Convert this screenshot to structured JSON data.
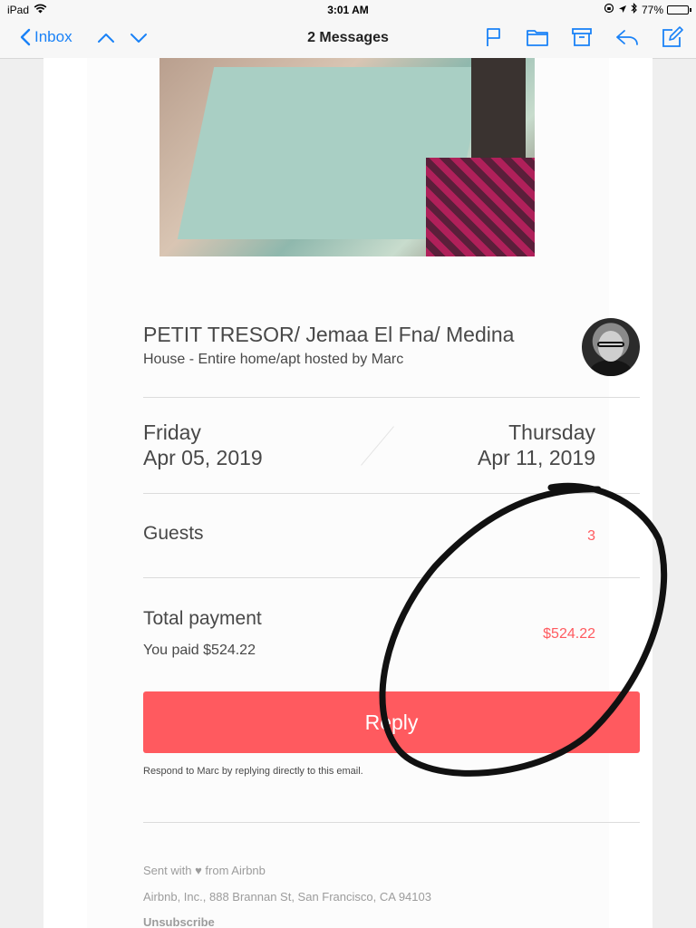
{
  "status_bar": {
    "device": "iPad",
    "time": "3:01 AM",
    "battery": "77%",
    "battery_level": 0.77
  },
  "nav": {
    "back_label": "Inbox",
    "title": "2 Messages"
  },
  "listing": {
    "title": "PETIT TRESOR/ Jemaa El Fna/ Medina",
    "subtitle": "House - Entire home/apt hosted by Marc"
  },
  "dates": {
    "checkin_day": "Friday",
    "checkin_date": "Apr 05, 2019",
    "checkout_day": "Thursday",
    "checkout_date": "Apr 11, 2019"
  },
  "guests": {
    "label": "Guests",
    "value": "3"
  },
  "payment": {
    "label": "Total payment",
    "paid_text": "You paid $524.22",
    "value": "$524.22"
  },
  "reply": {
    "button_label": "Reply",
    "hint": "Respond to Marc by replying directly to this email."
  },
  "footer": {
    "sent_with": "Sent with ♥ from Airbnb",
    "address": "Airbnb, Inc., 888 Brannan St, San Francisco, CA 94103",
    "unsubscribe": "Unsubscribe"
  },
  "colors": {
    "accent": "#ff5a5f",
    "ios_blue": "#1a82f7",
    "text": "#484848"
  }
}
